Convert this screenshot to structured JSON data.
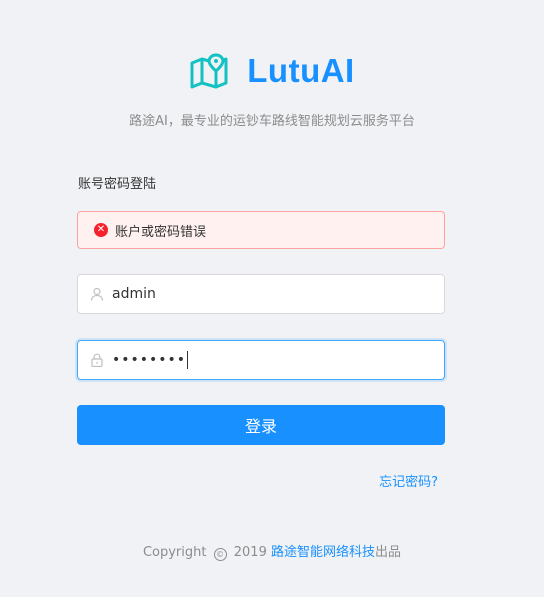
{
  "header": {
    "logo_icon": "map-icon",
    "title": "LutuAI",
    "tagline": "路途AI，最专业的运钞车路线智能规划云服务平台"
  },
  "form": {
    "title": "账号密码登陆",
    "error": {
      "icon": "close-circle-icon",
      "message": "账户或密码错误"
    },
    "username": {
      "icon": "user-icon",
      "value": "admin",
      "placeholder": ""
    },
    "password": {
      "icon": "lock-icon",
      "value": "••••••••",
      "placeholder": ""
    },
    "submit_label": "登录",
    "forgot_label": "忘记密码?"
  },
  "footer": {
    "prefix": "Copyright",
    "copyright_symbol": "©",
    "year": "2019",
    "company": "路途智能网络科技",
    "suffix": "出品"
  },
  "colors": {
    "primary": "#1890ff",
    "logo_icon": "#13c2c2",
    "error": "#f5222d",
    "error_bg": "#fff1f0",
    "background": "#f0f2f5"
  }
}
